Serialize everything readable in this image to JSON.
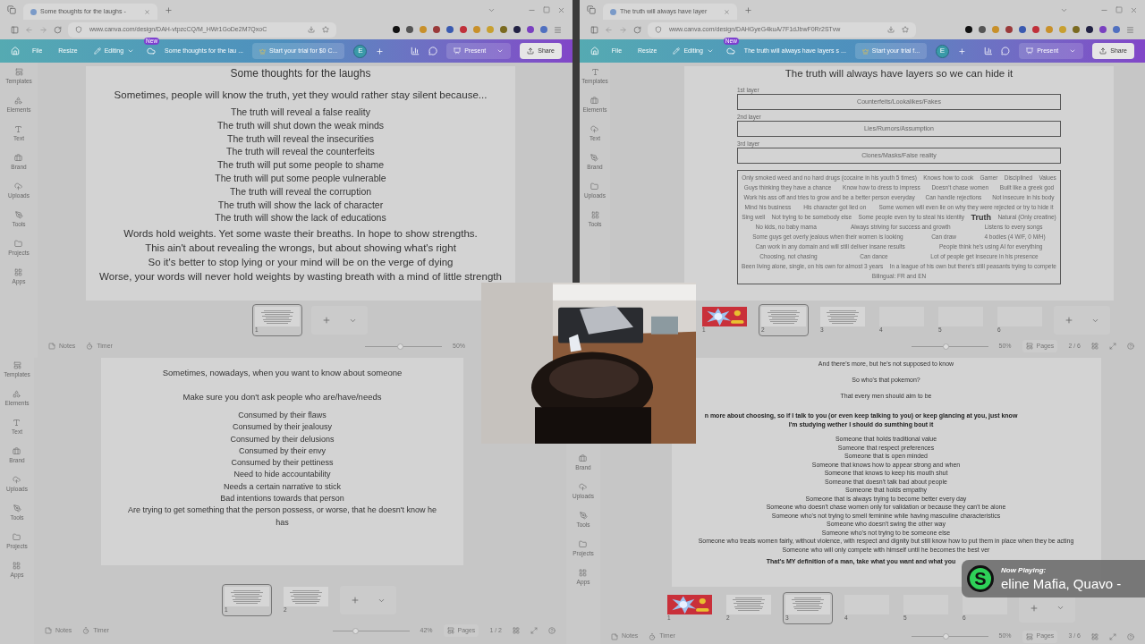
{
  "top_windows": [
    {
      "browser": {
        "tab_title": "Some thoughts for the laughs -",
        "url": "www.canva.com/design/DAH-vtpzcCQ/M_HWr1GoDe2M7QxoC"
      },
      "toolbar": {
        "menu": [
          "File",
          "Resize"
        ],
        "mode": "Editing",
        "badge": "New",
        "doc_title": "Some thoughts for the lau ...",
        "trial": "Start your trial for $0 C...",
        "avatar": "E",
        "present": "Present",
        "share": "Share"
      },
      "sidebar": [
        "Templates",
        "Elements",
        "Text",
        "Brand",
        "Uploads",
        "Tools",
        "Projects",
        "Apps"
      ],
      "page": {
        "kind": "poem",
        "blocks": [
          {
            "kind": "heading",
            "text": "Some thoughts for the laughs"
          },
          {
            "kind": "lines",
            "lines": [
              "Sometimes, people will know the truth, yet they would rather stay silent because..."
            ]
          },
          {
            "kind": "list",
            "lines": [
              "The truth will reveal a false reality",
              "The truth will shut down the weak minds",
              "The truth will reveal the insecurities",
              "The truth will reveal the counterfeits",
              "The truth will put some people to shame",
              "The truth will put some people vulnerable",
              "The truth will reveal the corruption",
              "The truth will show the lack of character",
              "The truth will show the lack of educations"
            ]
          },
          {
            "kind": "lines",
            "lines": [
              "Words hold weights. Yet some waste their breaths. In hope to show strengths.",
              "This ain't about revealing the wrongs, but about showing what's right",
              "So it's better to stop lying or your mind will be on the verge of dying",
              "Worse, your words will never hold weights by wasting breath with a mind of little strength"
            ]
          }
        ]
      },
      "thumbnails": [
        {
          "number": "1",
          "kind": "text",
          "selected": true
        }
      ],
      "footer": {
        "notes": "Notes",
        "timer": "Timer",
        "level": 0.45,
        "zoom": "50%"
      }
    },
    {
      "browser": {
        "tab_title": "The truth will always have layer",
        "url": "www.canva.com/design/DAHGyeG4kuA/7F1dJbwF0Rr2STvw"
      },
      "toolbar": {
        "menu": [
          "File",
          "Resize"
        ],
        "mode": "Editing",
        "badge": "New",
        "doc_title": "The truth will always have layers s ...",
        "trial": "Start your trial f...",
        "avatar": "E",
        "present": "Present",
        "share": "Share"
      },
      "sidebar": [
        "Templates",
        "Elements",
        "Text",
        "Brand",
        "Uploads",
        "Tools"
      ],
      "page": {
        "kind": "layers",
        "blocks": [
          {
            "kind": "heading",
            "text": "The truth will always have layers so we can hide it"
          },
          {
            "kind": "layer",
            "label": "1st layer",
            "text": "Counterfeits/Lookalikes/Fakes"
          },
          {
            "kind": "layer",
            "label": "2nd layer",
            "text": "Lies/Rumors/Assumption"
          },
          {
            "kind": "layer",
            "label": "3rd layer",
            "text": "Clones/Masks/False reality"
          },
          {
            "kind": "cloud",
            "words": [
              {
                "text": "Only smoked weed and no hard drugs (cocaine in his youth 5 times)",
                "bold": false
              },
              {
                "text": "Knows how to cook",
                "bold": false
              },
              {
                "text": "Gamer",
                "bold": false
              },
              {
                "text": "Disciplined",
                "bold": false
              },
              {
                "text": "Values",
                "bold": false
              },
              {
                "text": "Guys thinking they have a chance",
                "bold": false
              },
              {
                "text": "Know how to dress to impress",
                "bold": false
              },
              {
                "text": "Doesn't chase women",
                "bold": false
              },
              {
                "text": "Built like a greek god",
                "bold": false
              },
              {
                "text": "Work his ass off and tries to grow and be a better person everyday",
                "bold": false
              },
              {
                "text": "Can handle rejections",
                "bold": false
              },
              {
                "text": "Not insecure in his body",
                "bold": false
              },
              {
                "text": "Mind his business",
                "bold": false
              },
              {
                "text": "His character got lied on",
                "bold": false
              },
              {
                "text": "Some women will even lie on why they were rejected or try to hide it",
                "bold": false
              },
              {
                "text": "Sing well",
                "bold": false
              },
              {
                "text": "Not trying to be somebody else",
                "bold": false
              },
              {
                "text": "Some people even try to steal his identity",
                "bold": false
              },
              {
                "text": "Truth",
                "bold": true
              },
              {
                "text": "Natural (Only creatine)",
                "bold": false
              },
              {
                "text": "No kids, no baby mama",
                "bold": false
              },
              {
                "text": "Always striving for success and growth",
                "bold": false
              },
              {
                "text": "Listens to every songs",
                "bold": false
              },
              {
                "text": "Some guys get overly jealous when their women is looking",
                "bold": false
              },
              {
                "text": "Can draw",
                "bold": false
              },
              {
                "text": "4 bodies (4 W/F, 0 M/H)",
                "bold": false
              },
              {
                "text": "Can work in any domain and will still deliver insane results",
                "bold": false
              },
              {
                "text": "People think he's using AI for everything",
                "bold": false
              },
              {
                "text": "Choosing, not chasing",
                "bold": false
              },
              {
                "text": "Can dance",
                "bold": false
              },
              {
                "text": "Lot of people get insecure in his presence",
                "bold": false
              },
              {
                "text": "Been living alone, single, on his own for almost 3 years",
                "bold": false
              },
              {
                "text": "In a league of his own but there's still peasants trying to compete",
                "bold": false
              },
              {
                "text": "Bilingual: FR and EN",
                "bold": false
              }
            ]
          }
        ]
      },
      "thumbnails": [
        {
          "number": "1",
          "kind": "picture",
          "selected": false
        },
        {
          "number": "2",
          "kind": "text",
          "selected": true
        },
        {
          "number": "3",
          "kind": "text",
          "selected": false
        },
        {
          "number": "4",
          "kind": "blank",
          "selected": false
        },
        {
          "number": "5",
          "kind": "blank",
          "selected": false
        },
        {
          "number": "6",
          "kind": "blank",
          "selected": false
        }
      ],
      "footer": {
        "level": 0.45,
        "zoom": "50%",
        "pages": "Pages",
        "count": "2 / 6"
      }
    }
  ],
  "bottom_windows": [
    {
      "sidebar": [
        "Templates",
        "Elements",
        "Text",
        "Brand",
        "Uploads",
        "Tools",
        "Projects",
        "Apps"
      ],
      "page": {
        "kind": "checklist",
        "blocks": [
          {
            "kind": "lines",
            "lines": [
              "Sometimes, nowadays, when you want to know about someone"
            ]
          },
          {
            "kind": "lines",
            "lines": [
              "Make sure you don't ask people who are/have/needs"
            ]
          },
          {
            "kind": "list",
            "lines": [
              "Consumed by their flaws",
              "Consumed by their jealousy",
              "Consumed by their delusions",
              "Consumed by their envy",
              "Consumed by their pettiness",
              "Need to hide accountability",
              "Needs a certain narrative to stick",
              "Bad intentions towards that person",
              "Are trying to get something that the person possess, or worse, that he doesn't know he has"
            ]
          }
        ]
      },
      "thumbnails": [
        {
          "number": "1",
          "kind": "text",
          "selected": true
        },
        {
          "number": "2",
          "kind": "text",
          "selected": false
        }
      ],
      "footer": {
        "notes": "Notes",
        "timer": "Timer",
        "level": 0.3,
        "zoom": "42%",
        "pages": "Pages",
        "count": "1 / 2"
      }
    },
    {
      "sidebar": [
        "Brand",
        "Uploads",
        "Tools",
        "Projects",
        "Apps"
      ],
      "page": {
        "kind": "profile",
        "blocks": [
          {
            "kind": "lines",
            "lines": [
              "And there's more, but he's not supposed to know"
            ]
          },
          {
            "kind": "lines",
            "lines": [
              "So who's that pokemon?"
            ]
          },
          {
            "kind": "lines",
            "lines": [
              "That every men should aim to be"
            ]
          },
          {
            "kind": "bold",
            "lines": [
              "n more about choosing, so if I talk to you (or even keep talking to you) or keep glancing at you, just know I'm studying wether I should do sumthing bout it"
            ]
          },
          {
            "kind": "list",
            "lines": [
              "Someone that holds traditional value",
              "Someone that respect preferences",
              "Someone that is open minded",
              "Someone that knows how to appear strong and when",
              "Someone that knows to keep his mouth shut",
              "Someone that doesn't talk bad about people",
              "Someone that holds empathy",
              "Someone that is always trying to become better every day",
              "Someone who doesn't chase women only for validation or because they can't be alone",
              "Someone who's not trying to smell feminine while having masculine characteristics",
              "Someone who doesn't swing the other way",
              "Someone who's not trying to be someone else",
              "Someone who treats women fairly, without violence, with respect and dignity but still know how to put them in place when they be acting",
              "Someone who will only compete with himself until he becomes the best ver"
            ]
          },
          {
            "kind": "bold",
            "lines": [
              "That's MY definition of a man, take what you want and what you"
            ]
          }
        ]
      },
      "thumbnails": [
        {
          "number": "1",
          "kind": "picture",
          "selected": false
        },
        {
          "number": "2",
          "kind": "text",
          "selected": false
        },
        {
          "number": "3",
          "kind": "text",
          "selected": true
        },
        {
          "number": "4",
          "kind": "blank",
          "selected": false
        },
        {
          "number": "5",
          "kind": "blank",
          "selected": false
        },
        {
          "number": "6",
          "kind": "blank",
          "selected": false
        }
      ],
      "footer": {
        "notes": "Notes",
        "timer": "Timer",
        "level": 0.45,
        "zoom": "50%",
        "pages": "Pages",
        "count": "3 / 6"
      }
    }
  ],
  "now_playing": {
    "label": "Now Playing:",
    "logo": "S",
    "track": "eline Mafia, Quavo -"
  }
}
